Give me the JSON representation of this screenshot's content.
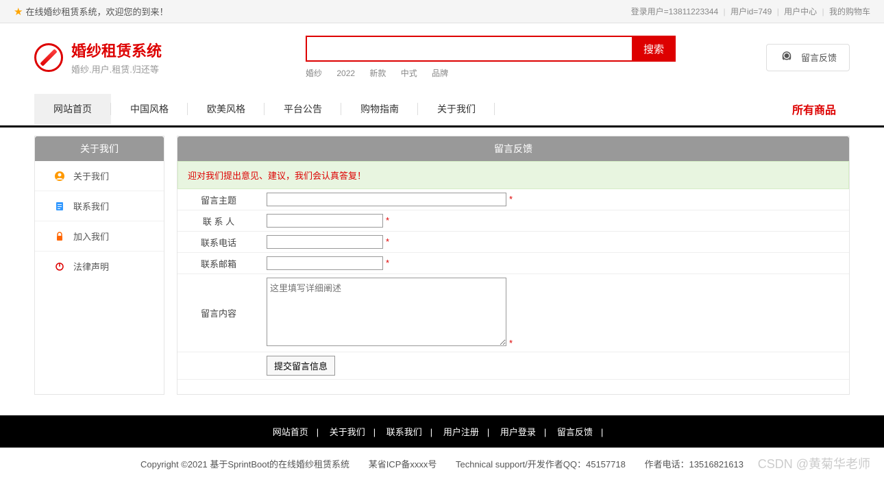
{
  "topbar": {
    "welcome": "在线婚纱租赁系统，欢迎您的到来！",
    "login_user": "登录用户=13811223344",
    "user_id": "用户id=749",
    "user_center": "用户中心",
    "my_cart": "我的购物车"
  },
  "header": {
    "logo_title": "婚纱租赁系统",
    "logo_sub": "婚纱.用户.租赁.归还等",
    "search_btn": "搜索",
    "search_tags": [
      "婚纱",
      "2022",
      "新款",
      "中式",
      "品牌"
    ],
    "feedback_btn": "留言反馈"
  },
  "nav": {
    "items": [
      "网站首页",
      "中国风格",
      "欧美风格",
      "平台公告",
      "购物指南",
      "关于我们"
    ],
    "all_products": "所有商品"
  },
  "sidebar": {
    "title": "关于我们",
    "items": [
      {
        "label": "关于我们",
        "icon": "user-circle",
        "color": "#f90"
      },
      {
        "label": "联系我们",
        "icon": "clipboard",
        "color": "#39f"
      },
      {
        "label": "加入我们",
        "icon": "lock",
        "color": "#f60"
      },
      {
        "label": "法律声明",
        "icon": "power",
        "color": "#d00"
      }
    ]
  },
  "content": {
    "title": "留言反馈",
    "notice": "迎对我们提出意见、建议，我们会认真答复！",
    "form": {
      "subject_label": "留言主题",
      "contact_label": "联 系 人",
      "phone_label": "联系电话",
      "email_label": "联系邮箱",
      "body_label": "留言内容",
      "body_placeholder": "这里填写详细阐述",
      "submit": "提交留言信息"
    }
  },
  "footer": {
    "nav": [
      "网站首页",
      "关于我们",
      "联系我们",
      "用户注册",
      "用户登录",
      "留言反馈"
    ],
    "copyright": "Copyright ©2021 基于SprintBoot的在线婚纱租赁系统",
    "icp": "某省ICP备xxxx号",
    "support": "Technical support/开发作者QQ：45157718",
    "phone": "作者电话：13516821613",
    "watermark": "CSDN @黄菊华老师"
  }
}
